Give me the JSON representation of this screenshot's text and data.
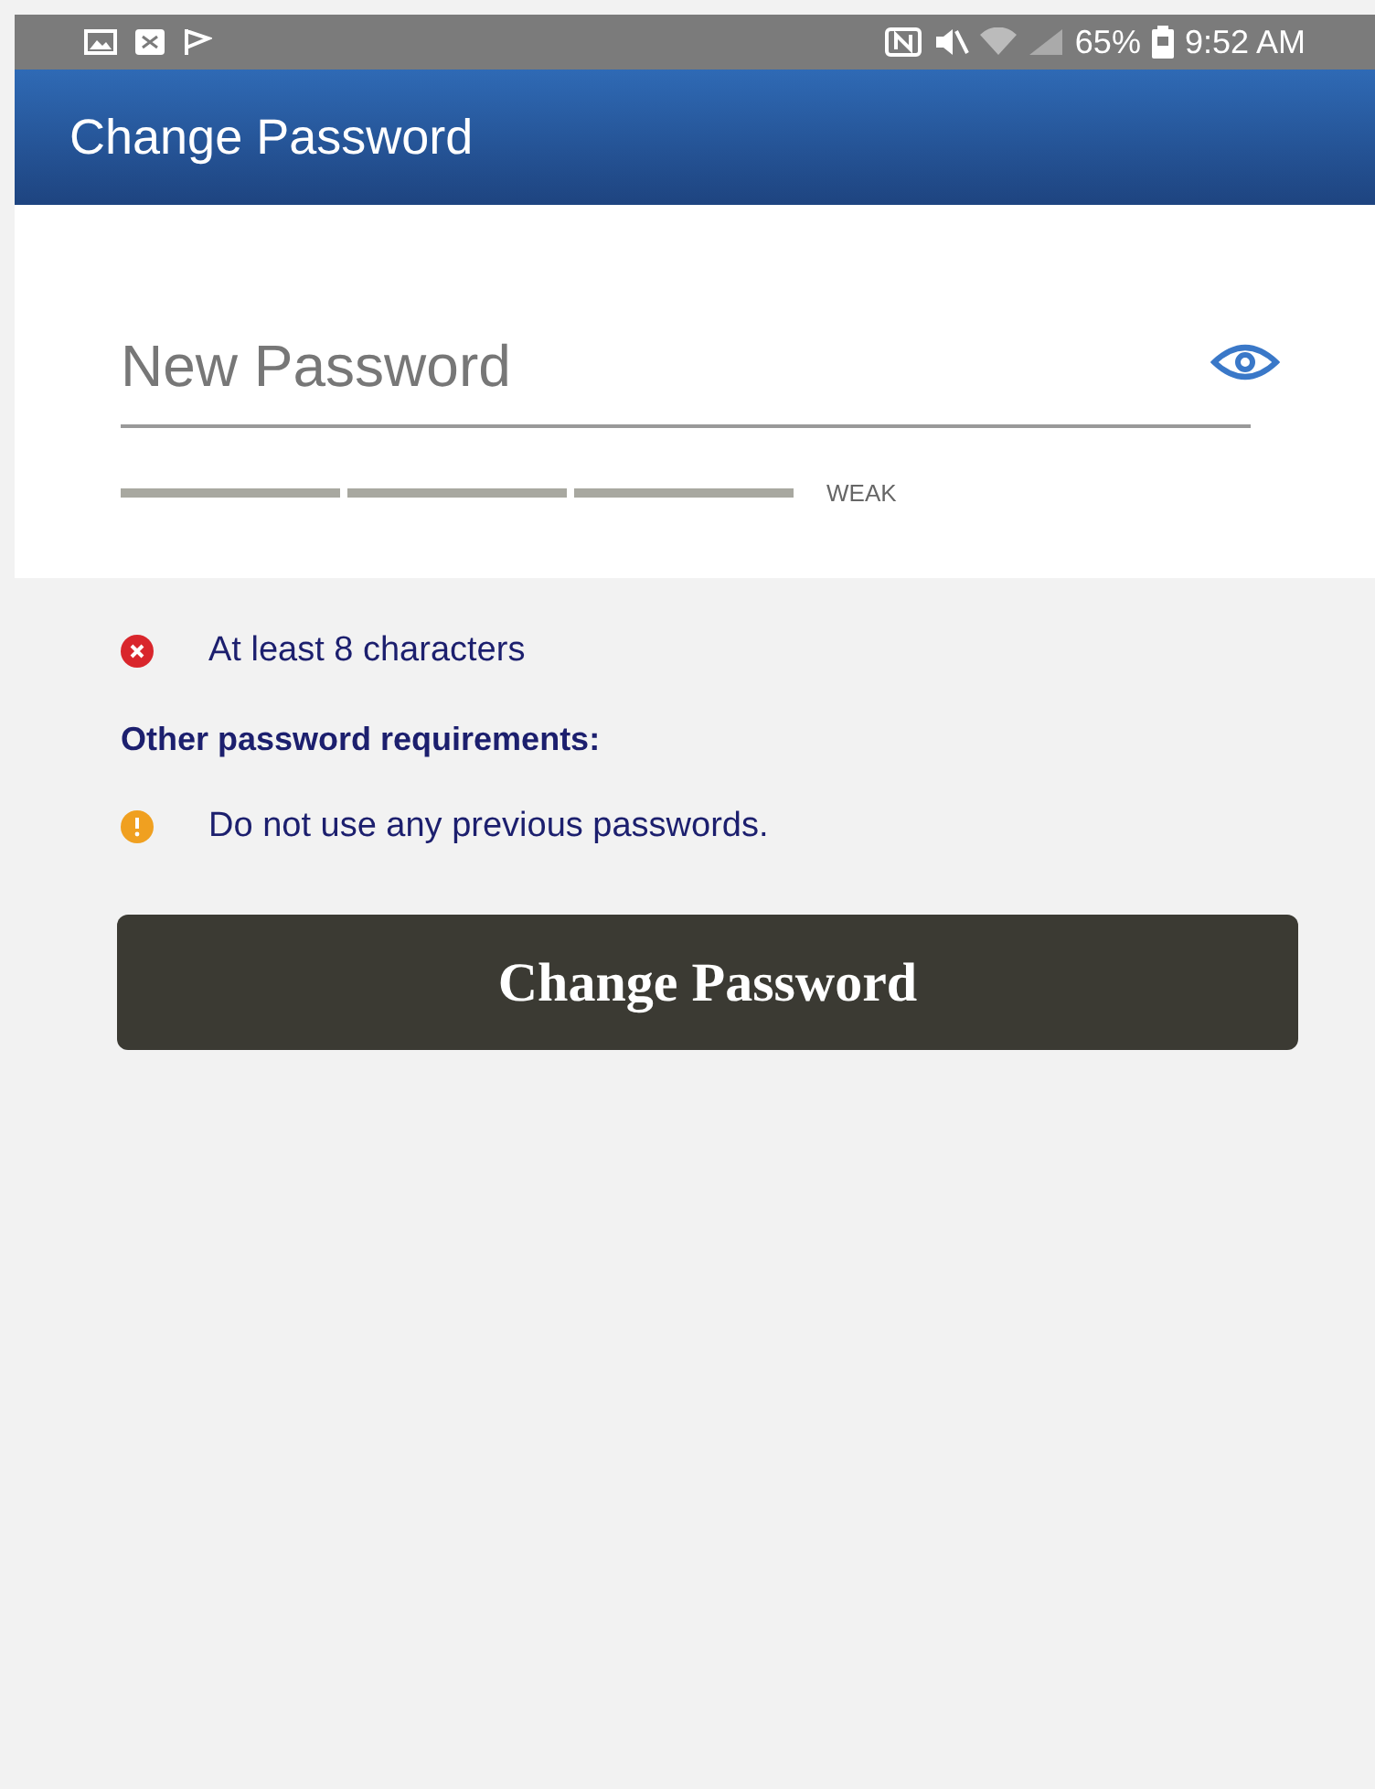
{
  "status_bar": {
    "battery": "65%",
    "time": "9:52 AM"
  },
  "app_bar": {
    "title": "Change Password"
  },
  "password_field": {
    "placeholder": "New Password"
  },
  "strength": {
    "label": "WEAK"
  },
  "requirements": [
    {
      "kind": "fail",
      "text": "At least 8 characters"
    }
  ],
  "other_requirements": {
    "heading": "Other password requirements:",
    "items": [
      {
        "kind": "warning",
        "text": "Do not use any previous passwords."
      }
    ]
  },
  "submit_button": {
    "label": "Change Password"
  }
}
